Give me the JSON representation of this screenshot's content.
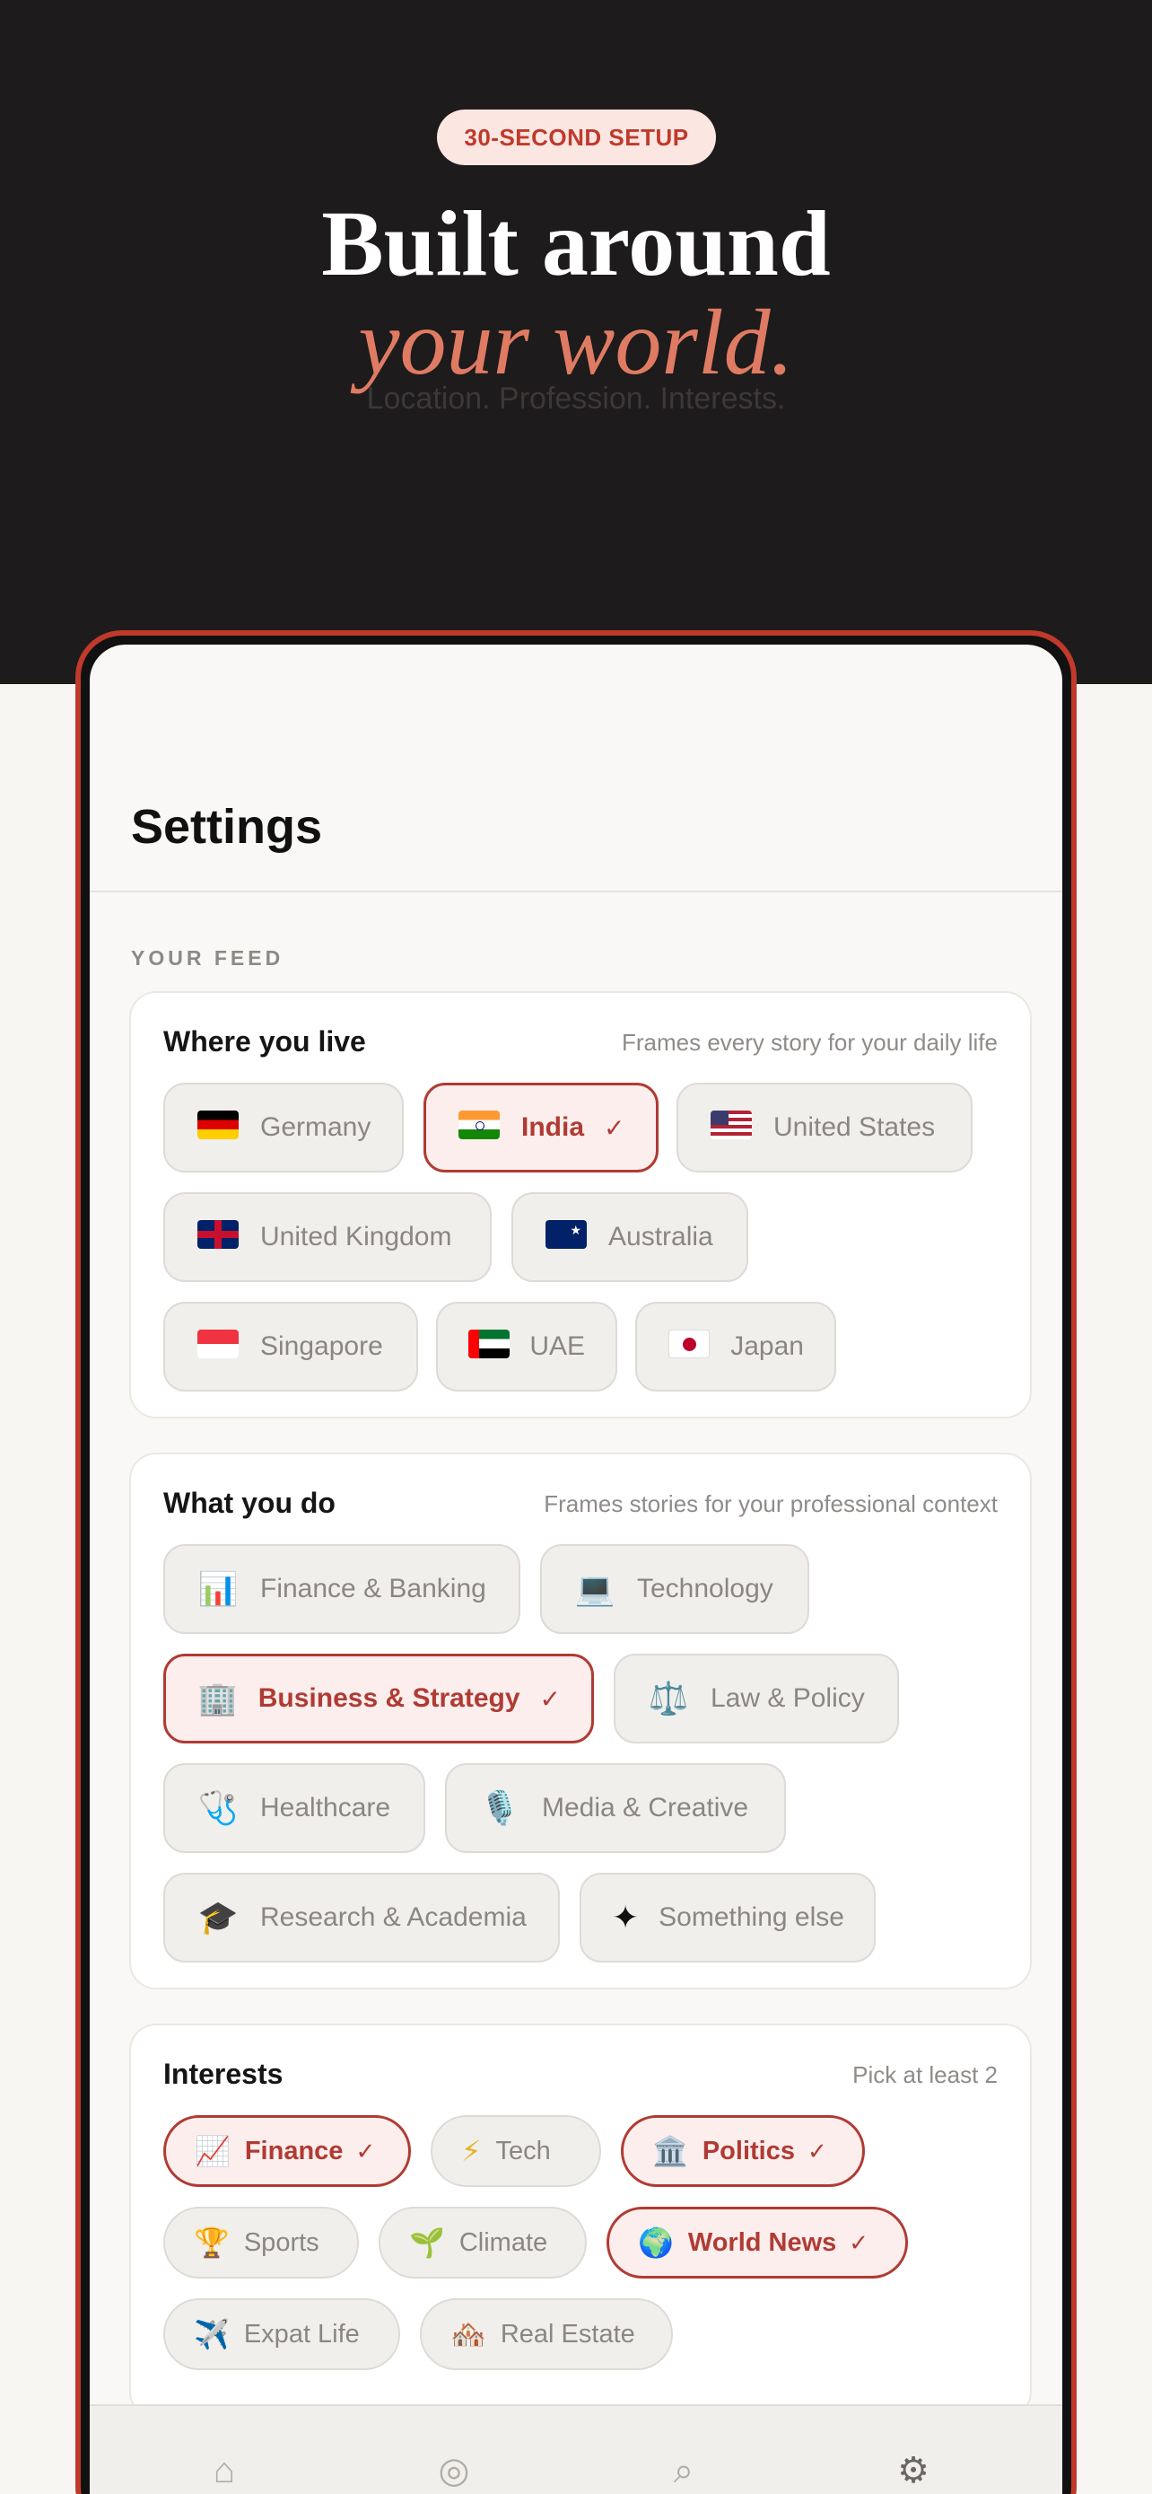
{
  "hero": {
    "badge": "30-SECOND SETUP",
    "title": "Built around",
    "subtitle": "your world.",
    "tagline": "Location. Profession. Interests."
  },
  "settings": {
    "title": "Settings",
    "section_label": "YOUR FEED"
  },
  "location": {
    "title": "Where you live",
    "hint": "Frames every story for your daily life",
    "options": [
      {
        "label": "Germany",
        "flag": "germany-flag",
        "selected": false
      },
      {
        "label": "India",
        "flag": "india-flag",
        "selected": true
      },
      {
        "label": "United States",
        "flag": "us-flag",
        "selected": false
      },
      {
        "label": "United Kingdom",
        "flag": "uk-flag",
        "selected": false
      },
      {
        "label": "Australia",
        "flag": "australia-flag",
        "selected": false
      },
      {
        "label": "Singapore",
        "flag": "singapore-flag",
        "selected": false
      },
      {
        "label": "UAE",
        "flag": "uae-flag",
        "selected": false
      },
      {
        "label": "Japan",
        "flag": "japan-flag",
        "selected": false
      }
    ]
  },
  "profession": {
    "title": "What you do",
    "hint": "Frames stories for your professional context",
    "options": [
      {
        "label": "Finance & Banking",
        "icon": "📊",
        "selected": false
      },
      {
        "label": "Technology",
        "icon": "💻",
        "selected": false
      },
      {
        "label": "Business & Strategy",
        "icon": "🏢",
        "selected": true
      },
      {
        "label": "Law & Policy",
        "icon": "⚖️",
        "selected": false
      },
      {
        "label": "Healthcare",
        "icon": "🩺",
        "selected": false
      },
      {
        "label": "Media & Creative",
        "icon": "🎙️",
        "selected": false
      },
      {
        "label": "Research & Academia",
        "icon": "🎓",
        "selected": false
      },
      {
        "label": "Something else",
        "icon": "✦",
        "selected": false
      }
    ]
  },
  "interests": {
    "title": "Interests",
    "hint": "Pick at least 2",
    "options": [
      {
        "label": "Finance",
        "icon": "📈",
        "selected": true
      },
      {
        "label": "Tech",
        "icon": "⚡",
        "selected": false
      },
      {
        "label": "Politics",
        "icon": "🏛️",
        "selected": true
      },
      {
        "label": "Sports",
        "icon": "🏆",
        "selected": false
      },
      {
        "label": "Climate",
        "icon": "🌱",
        "selected": false
      },
      {
        "label": "World News",
        "icon": "🌍",
        "selected": true
      },
      {
        "label": "Expat Life",
        "icon": "✈️",
        "selected": false
      },
      {
        "label": "Real Estate",
        "icon": "🏘️",
        "selected": false
      }
    ]
  },
  "check_mark": "✓",
  "tabbar": {
    "items": [
      {
        "icon": "⌂",
        "icon_name": "home-icon",
        "active": false
      },
      {
        "icon": "◎",
        "icon_name": "explore-icon",
        "active": false
      },
      {
        "icon": "⌕",
        "icon_name": "search-icon",
        "active": false
      },
      {
        "icon": "⚙",
        "icon_name": "settings-gear-icon",
        "active": true
      }
    ]
  },
  "colors": {
    "accent": "#c0392b",
    "hero_bg": "#1d1b1b",
    "subtitle": "#e07b63"
  }
}
